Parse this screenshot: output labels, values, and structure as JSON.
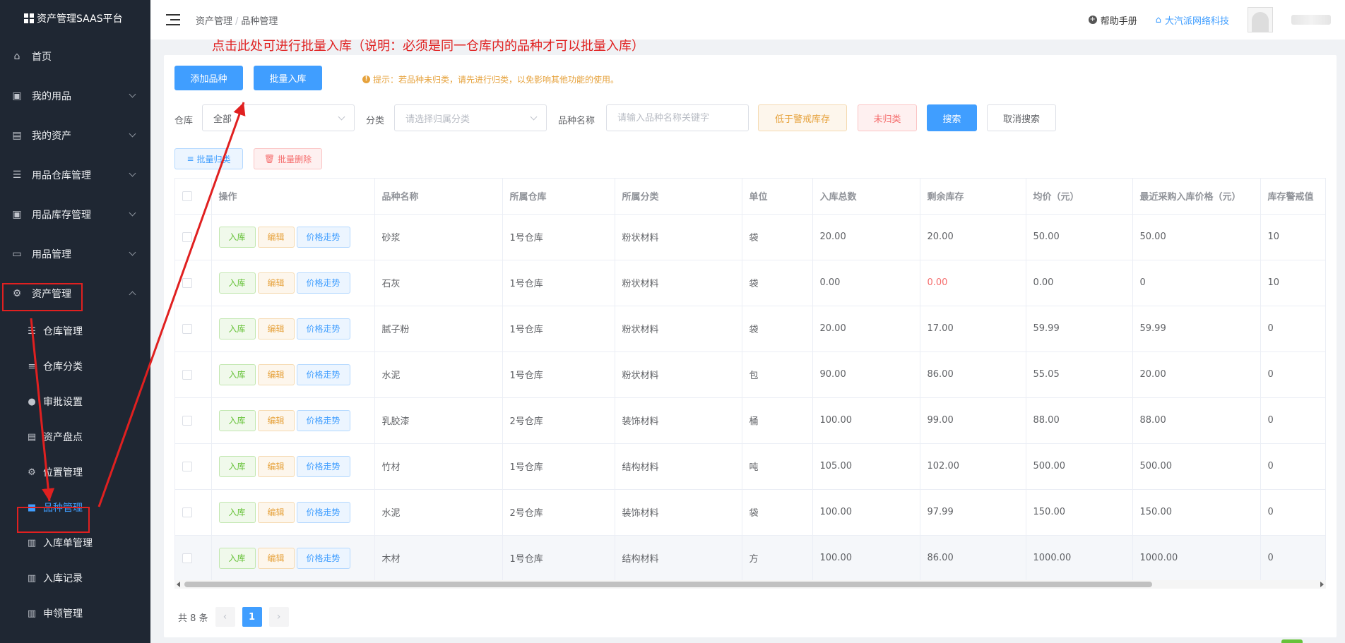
{
  "app": {
    "title": "资产管理SAAS平台"
  },
  "sidebar": {
    "items": [
      {
        "label": "首页"
      },
      {
        "label": "我的用品"
      },
      {
        "label": "我的资产"
      },
      {
        "label": "用品仓库管理"
      },
      {
        "label": "用品库存管理"
      },
      {
        "label": "用品管理"
      },
      {
        "label": "资产管理"
      }
    ],
    "subitems": [
      {
        "label": "仓库管理"
      },
      {
        "label": "仓库分类"
      },
      {
        "label": "审批设置"
      },
      {
        "label": "资产盘点"
      },
      {
        "label": "位置管理"
      },
      {
        "label": "品种管理"
      },
      {
        "label": "入库单管理"
      },
      {
        "label": "入库记录"
      },
      {
        "label": "申领管理"
      }
    ]
  },
  "header": {
    "breadcrumb": [
      "资产管理",
      "品种管理"
    ],
    "help": "帮助手册",
    "company": "大汽派网络科技"
  },
  "annotation": "点击此处可进行批量入库（说明：必须是同一仓库内的品种才可以批量入库）",
  "toolbar": {
    "add": "添加品种",
    "batch_in": "批量入库",
    "tip": "提示：若品种未归类，请先进行归类，以免影响其他功能的使用。"
  },
  "filters": {
    "warehouse_label": "仓库",
    "warehouse_value": "全部",
    "category_label": "分类",
    "category_placeholder": "请选择归属分类",
    "name_label": "品种名称",
    "name_placeholder": "请输入品种名称关键字",
    "low_stock": "低于警戒库存",
    "uncategorized": "未归类",
    "search": "搜索",
    "cancel": "取消搜索"
  },
  "actions": {
    "batch_classify": "批量归类",
    "batch_delete": "批量删除"
  },
  "table": {
    "headers": [
      "操作",
      "品种名称",
      "所属仓库",
      "所属分类",
      "单位",
      "入库总数",
      "剩余库存",
      "均价（元）",
      "最近采购入库价格（元）",
      "库存警戒值"
    ],
    "row_buttons": {
      "in": "入库",
      "edit": "编辑",
      "trend": "价格走势"
    },
    "rows": [
      {
        "name": "砂浆",
        "warehouse": "1号仓库",
        "category": "粉状材料",
        "unit": "袋",
        "total": "20.00",
        "stock": "20.00",
        "avg": "50.00",
        "last": "50.00",
        "alert": "10"
      },
      {
        "name": "石灰",
        "warehouse": "1号仓库",
        "category": "粉状材料",
        "unit": "袋",
        "total": "0.00",
        "stock": "0.00",
        "avg": "0.00",
        "last": "0",
        "alert": "10"
      },
      {
        "name": "腻子粉",
        "warehouse": "1号仓库",
        "category": "粉状材料",
        "unit": "袋",
        "total": "20.00",
        "stock": "17.00",
        "avg": "59.99",
        "last": "59.99",
        "alert": "0"
      },
      {
        "name": "水泥",
        "warehouse": "1号仓库",
        "category": "粉状材料",
        "unit": "包",
        "total": "90.00",
        "stock": "86.00",
        "avg": "55.05",
        "last": "20.00",
        "alert": "0"
      },
      {
        "name": "乳胶漆",
        "warehouse": "2号仓库",
        "category": "装饰材料",
        "unit": "桶",
        "total": "100.00",
        "stock": "99.00",
        "avg": "88.00",
        "last": "88.00",
        "alert": "0"
      },
      {
        "name": "竹材",
        "warehouse": "1号仓库",
        "category": "结构材料",
        "unit": "吨",
        "total": "105.00",
        "stock": "102.00",
        "avg": "500.00",
        "last": "500.00",
        "alert": "0"
      },
      {
        "name": "水泥",
        "warehouse": "2号仓库",
        "category": "装饰材料",
        "unit": "袋",
        "total": "100.00",
        "stock": "97.99",
        "avg": "150.00",
        "last": "150.00",
        "alert": "0"
      },
      {
        "name": "木材",
        "warehouse": "1号仓库",
        "category": "结构材料",
        "unit": "方",
        "total": "100.00",
        "stock": "86.00",
        "avg": "1000.00",
        "last": "1000.00",
        "alert": "0"
      }
    ]
  },
  "pagination": {
    "total": "共 8 条",
    "current": "1",
    "prev": "‹",
    "next": "›"
  },
  "colors": {
    "primary": "#409eff",
    "sidebar": "#1f2733",
    "annotation": "#e02020"
  }
}
